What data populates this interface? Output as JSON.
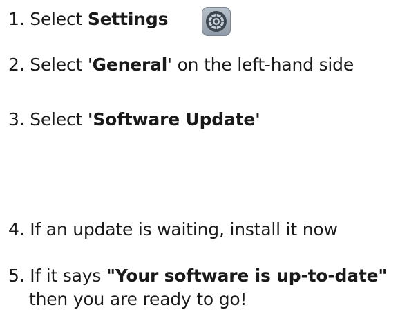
{
  "steps": [
    {
      "number": "1.",
      "pre": "Select ",
      "bold": "Settings",
      "post": ""
    },
    {
      "number": "2.",
      "pre": "Select '",
      "bold": "General",
      "post": "' on the left-hand side"
    },
    {
      "number": "3.",
      "pre": "Select ",
      "bold": "'Software Update'",
      "post": ""
    },
    {
      "number": "4.",
      "text": "If an update is waiting, install it now"
    },
    {
      "number": "5.",
      "pre": "If it says ",
      "bold": "\"Your software is up-to-date\"",
      "continuation": "then you are ready to go!"
    }
  ],
  "icons": {
    "settings_app": "gear-icon"
  }
}
